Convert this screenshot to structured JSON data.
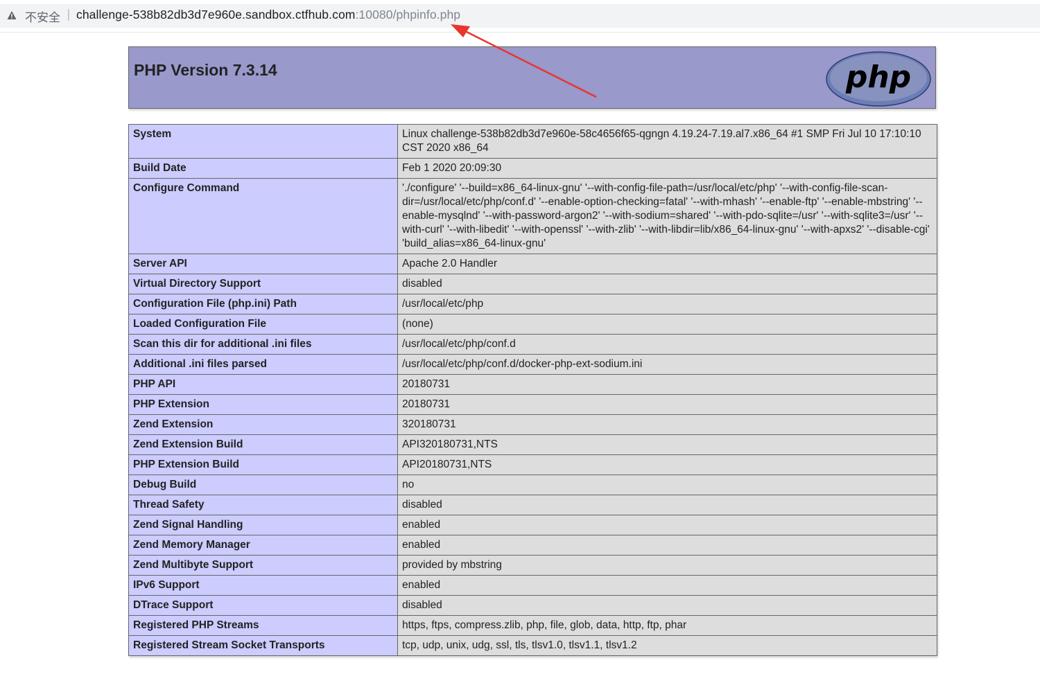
{
  "browser": {
    "security_label": "不安全",
    "separator": "|",
    "url_host": "challenge-538b82db3d7e960e.sandbox.ctfhub.com",
    "url_rest": ":10080/phpinfo.php",
    "warn_icon": "warning-triangle-icon"
  },
  "header": {
    "title": "PHP Version 7.3.14",
    "logo": "php-logo",
    "background": "#9999cc"
  },
  "annotation": {
    "color": "#e8352e",
    "description": "red arrow pointing at URL"
  },
  "rows": [
    {
      "key": "System",
      "value": "Linux challenge-538b82db3d7e960e-58c4656f65-qgngn 4.19.24-7.19.al7.x86_64 #1 SMP Fri Jul 10 17:10:10 CST 2020 x86_64"
    },
    {
      "key": "Build Date",
      "value": "Feb 1 2020 20:09:30"
    },
    {
      "key": "Configure Command",
      "value": "'./configure' '--build=x86_64-linux-gnu' '--with-config-file-path=/usr/local/etc/php' '--with-config-file-scan-dir=/usr/local/etc/php/conf.d' '--enable-option-checking=fatal' '--with-mhash' '--enable-ftp' '--enable-mbstring' '--enable-mysqlnd' '--with-password-argon2' '--with-sodium=shared' '--with-pdo-sqlite=/usr' '--with-sqlite3=/usr' '--with-curl' '--with-libedit' '--with-openssl' '--with-zlib' '--with-libdir=lib/x86_64-linux-gnu' '--with-apxs2' '--disable-cgi' 'build_alias=x86_64-linux-gnu'"
    },
    {
      "key": "Server API",
      "value": "Apache 2.0 Handler"
    },
    {
      "key": "Virtual Directory Support",
      "value": "disabled"
    },
    {
      "key": "Configuration File (php.ini) Path",
      "value": "/usr/local/etc/php"
    },
    {
      "key": "Loaded Configuration File",
      "value": "(none)"
    },
    {
      "key": "Scan this dir for additional .ini files",
      "value": "/usr/local/etc/php/conf.d"
    },
    {
      "key": "Additional .ini files parsed",
      "value": "/usr/local/etc/php/conf.d/docker-php-ext-sodium.ini"
    },
    {
      "key": "PHP API",
      "value": "20180731"
    },
    {
      "key": "PHP Extension",
      "value": "20180731"
    },
    {
      "key": "Zend Extension",
      "value": "320180731"
    },
    {
      "key": "Zend Extension Build",
      "value": "API320180731,NTS"
    },
    {
      "key": "PHP Extension Build",
      "value": "API20180731,NTS"
    },
    {
      "key": "Debug Build",
      "value": "no"
    },
    {
      "key": "Thread Safety",
      "value": "disabled"
    },
    {
      "key": "Zend Signal Handling",
      "value": "enabled"
    },
    {
      "key": "Zend Memory Manager",
      "value": "enabled"
    },
    {
      "key": "Zend Multibyte Support",
      "value": "provided by mbstring"
    },
    {
      "key": "IPv6 Support",
      "value": "enabled"
    },
    {
      "key": "DTrace Support",
      "value": "disabled"
    },
    {
      "key": "Registered PHP Streams",
      "value": "https, ftps, compress.zlib, php, file, glob, data, http, ftp, phar"
    },
    {
      "key": "Registered Stream Socket Transports",
      "value": "tcp, udp, unix, udg, ssl, tls, tlsv1.0, tlsv1.1, tlsv1.2"
    }
  ]
}
